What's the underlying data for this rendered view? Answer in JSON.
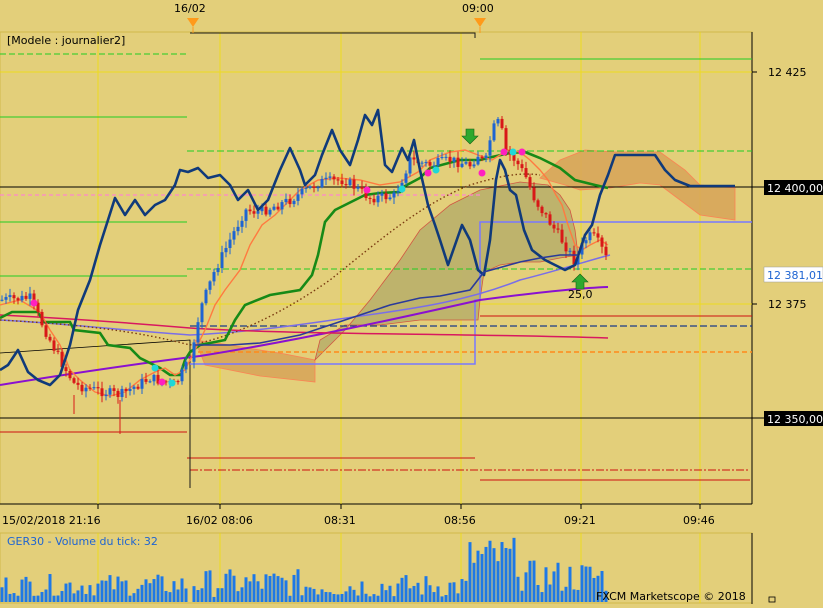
{
  "header": {
    "marker_labels": [
      "16/02",
      "09:00"
    ]
  },
  "main_panel": {
    "model_label": "[Modele : journalier2]",
    "y_ticks": [
      "12 425",
      "12 375"
    ],
    "price_boxes": [
      "12 400,00",
      "12 381,01",
      "12 350,00"
    ],
    "annotation": "25,0"
  },
  "x_ticks": [
    "15/02/2018 21:16",
    "16/02 08:06",
    "08:31",
    "08:56",
    "09:21",
    "09:46"
  ],
  "volume_panel": {
    "title": "GER30 - Volume du tick: 32"
  },
  "footer": {
    "copyright": "FXCM Marketscope © 2018"
  },
  "colors": {
    "background": "#e3cf7a",
    "border": "#d1b94a",
    "bullish": "#1e64d2",
    "bearish": "#d81818",
    "kijun": "#178a17",
    "tenkan": "#ff8040",
    "chikou": "#103a7a",
    "price_box": "#000000",
    "highlight_box": "#7878ff"
  },
  "chart_data": {
    "type": "candlestick",
    "symbol": "GER30",
    "model": "journalier2",
    "y_axis_ticks": [
      12425,
      12375
    ],
    "price_levels": [
      12400.0,
      12381.01,
      12350.0
    ],
    "ylim_approx": [
      12327,
      12437
    ],
    "x_axis_ticks": [
      "15/02/2018 21:16",
      "16/02 08:06",
      "08:31",
      "08:56",
      "09:21",
      "09:46"
    ],
    "session_markers": [
      "16/02",
      "09:00"
    ],
    "annotation_value": 25.0,
    "volume_title_value": 32,
    "grid": true
  }
}
